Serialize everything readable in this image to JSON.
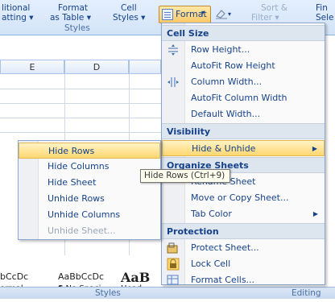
{
  "ribbon": {
    "conditional": [
      "litional",
      "atting ▾"
    ],
    "format_as_table": [
      "Format",
      "as Table ▾"
    ],
    "cell_styles": [
      "Cell",
      "Styles ▾"
    ],
    "styles_group_label": "Styles",
    "format_button": "Format",
    "format_arrow": "▾",
    "sort_filter": [
      "Sort &",
      "Filter ▾"
    ],
    "find_select": [
      "Fin",
      "Sele"
    ]
  },
  "sheet": {
    "col_e": "E",
    "col_d": "D"
  },
  "format_menu": {
    "cell_size_header": "Cell Size",
    "row_height": "Row Height...",
    "autofit_row": "AutoFit Row Height",
    "column_width": "Column Width...",
    "autofit_column": "AutoFit Column Width",
    "default_width": "Default Width...",
    "visibility_header": "Visibility",
    "hide_unhide": "Hide & Unhide",
    "organize_header": "Organize Sheets",
    "rename_sheet": "Rename Sheet",
    "move_copy": "Move or Copy Sheet...",
    "tab_color": "Tab Color",
    "protection_header": "Protection",
    "protect_sheet": "Protect Sheet...",
    "lock_cell": "Lock Cell",
    "format_cells": "Format Cells..."
  },
  "hide_submenu": {
    "hide_rows": "Hide Rows",
    "hide_columns": "Hide Columns",
    "hide_sheet": "Hide Sheet",
    "unhide_rows": "Unhide Rows",
    "unhide_columns": "Unhide Columns",
    "unhide_sheet": "Unhide Sheet..."
  },
  "tooltip": "Hide Rows (Ctrl+9)",
  "gallery": {
    "cell1_top": "bCcDc",
    "cell1_bottom": "ormal",
    "cell2_top": "AaBbCcDc",
    "cell2_bottom": "¶ No Spaci...",
    "cell3_top": "AaB",
    "cell3_bottom": "Head"
  },
  "status": {
    "styles_label": "Styles",
    "editing_label": "Editing"
  },
  "colors": {
    "ribbon_bg": "#d3e3f8",
    "highlight": "#ffd772",
    "menu_header": "#dde5ef",
    "text": "#15428b"
  }
}
